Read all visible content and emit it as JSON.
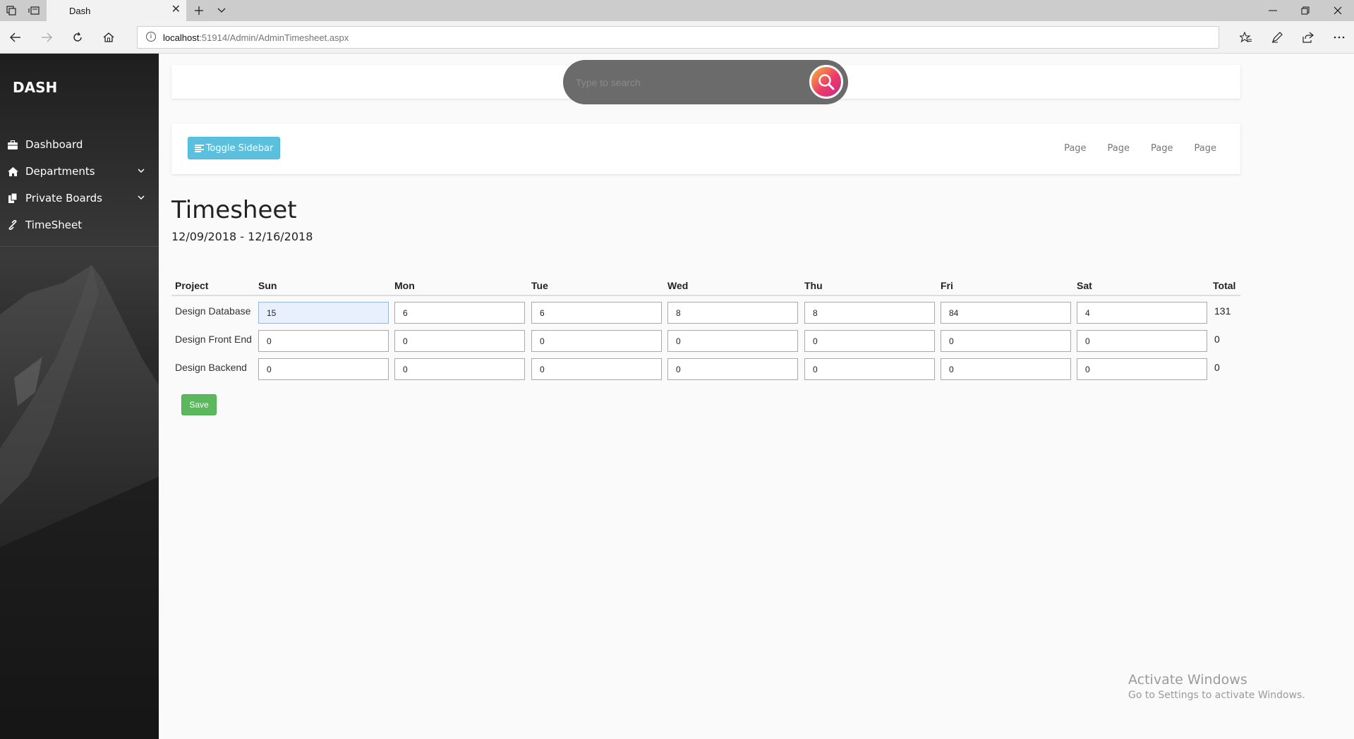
{
  "browser": {
    "tab_title": "Dash",
    "url_host": "localhost",
    "url_path": ":51914/Admin/AdminTimesheet.aspx"
  },
  "sidebar": {
    "brand": "DASH",
    "items": [
      {
        "label": "Dashboard",
        "icon": "briefcase-icon",
        "has_submenu": false
      },
      {
        "label": "Departments",
        "icon": "home-icon",
        "has_submenu": true
      },
      {
        "label": "Private Boards",
        "icon": "copy-icon",
        "has_submenu": true
      },
      {
        "label": "TimeSheet",
        "icon": "link-icon",
        "has_submenu": false
      }
    ]
  },
  "search": {
    "placeholder": "Type to search"
  },
  "navbar": {
    "toggle_label": "Toggle Sidebar",
    "links": [
      "Page",
      "Page",
      "Page",
      "Page"
    ]
  },
  "main": {
    "title": "Timesheet",
    "date_range": "12/09/2018 - 12/16/2018"
  },
  "timesheet": {
    "headers": {
      "project": "Project",
      "days": [
        "Sun",
        "Mon",
        "Tue",
        "Wed",
        "Thu",
        "Fri",
        "Sat"
      ],
      "total": "Total"
    },
    "rows": [
      {
        "project": "Design Database",
        "hours": [
          "15",
          "6",
          "6",
          "8",
          "8",
          "84",
          "4"
        ],
        "total": "131"
      },
      {
        "project": "Design Front End",
        "hours": [
          "0",
          "0",
          "0",
          "0",
          "0",
          "0",
          "0"
        ],
        "total": "0"
      },
      {
        "project": "Design Backend",
        "hours": [
          "0",
          "0",
          "0",
          "0",
          "0",
          "0",
          "0"
        ],
        "total": "0"
      }
    ],
    "save_label": "Save"
  },
  "watermark": {
    "line1": "Activate Windows",
    "line2": "Go to Settings to activate Windows."
  },
  "colors": {
    "sidebar_bg": "#1c1c1c",
    "toggle_button": "#5bc0de",
    "save_button": "#5cb85c",
    "search_pill": "#6b6b6b"
  }
}
